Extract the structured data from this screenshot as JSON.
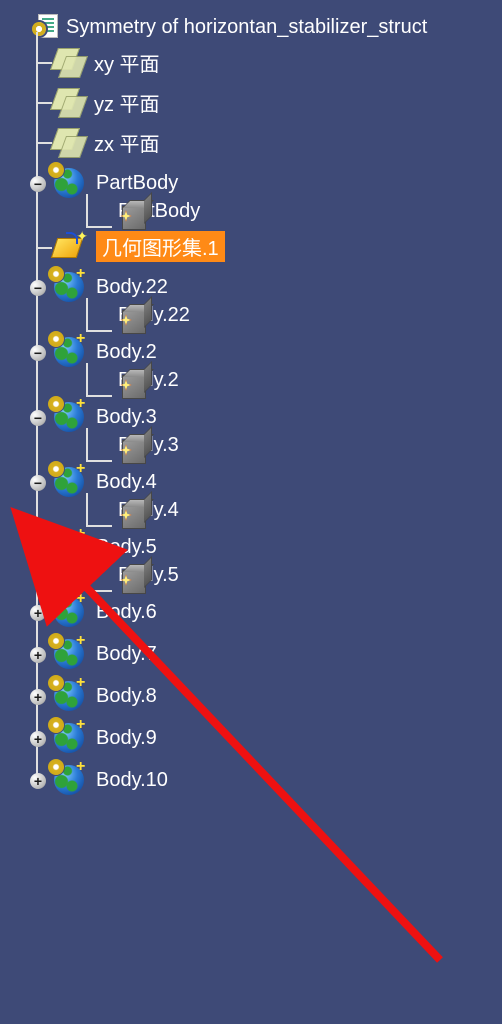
{
  "root": {
    "label": "Symmetry of horizontan_stabilizer_struct"
  },
  "planes": [
    {
      "label": "xy 平面"
    },
    {
      "label": "yz 平面"
    },
    {
      "label": "zx 平面"
    }
  ],
  "partbody": {
    "label": "PartBody",
    "solid_label": "PartBody"
  },
  "geoset": {
    "label": "几何图形集.1"
  },
  "bodies_expanded": [
    {
      "label": "Body.22",
      "solid_label": "Body.22"
    },
    {
      "label": "Body.2",
      "solid_label": "Body.2"
    },
    {
      "label": "Body.3",
      "solid_label": "Body.3"
    },
    {
      "label": "Body.4",
      "solid_label": "Body.4"
    },
    {
      "label": "Body.5",
      "solid_label": "Body.5"
    }
  ],
  "bodies_collapsed": [
    {
      "label": "Body.6"
    },
    {
      "label": "Body.7"
    },
    {
      "label": "Body.8"
    },
    {
      "label": "Body.9"
    },
    {
      "label": "Body.10"
    }
  ]
}
